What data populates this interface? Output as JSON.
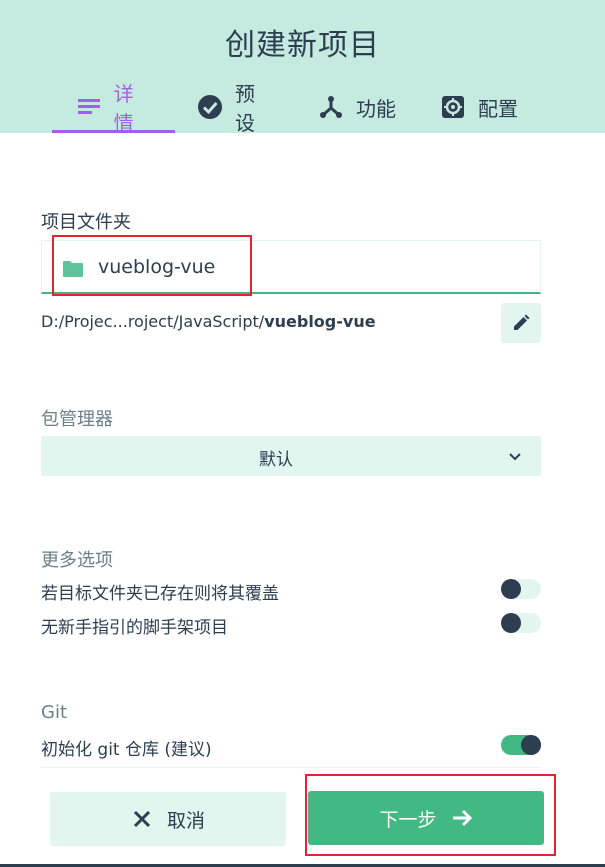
{
  "header": {
    "title": "创建新项目",
    "tabs": [
      {
        "label": "详情",
        "icon": "list-icon",
        "active": true
      },
      {
        "label": "预设",
        "icon": "check-circle-icon",
        "active": false
      },
      {
        "label": "功能",
        "icon": "fork-icon",
        "active": false
      },
      {
        "label": "配置",
        "icon": "gear-icon",
        "active": false
      }
    ]
  },
  "project_folder": {
    "label": "项目文件夹",
    "value": "vueblog-vue",
    "path_prefix": "D:/Projec...roject/JavaScript/",
    "path_bold": "vueblog-vue"
  },
  "package_manager": {
    "label": "包管理器",
    "selected": "默认"
  },
  "more_options": {
    "label": "更多选项",
    "items": [
      {
        "label": "若目标文件夹已存在则将其覆盖",
        "enabled": false
      },
      {
        "label": "无新手指引的脚手架项目",
        "enabled": false
      }
    ]
  },
  "git": {
    "label": "Git",
    "init_label": "初始化 git 仓库 (建议)",
    "init_enabled": true
  },
  "footer": {
    "cancel_label": "取消",
    "next_label": "下一步"
  },
  "colors": {
    "header_bg": "#c5eadf",
    "accent_purple": "#a55eea",
    "primary_green": "#42b983",
    "text_dark": "#2c3e50",
    "highlight_red": "#e0252e"
  }
}
